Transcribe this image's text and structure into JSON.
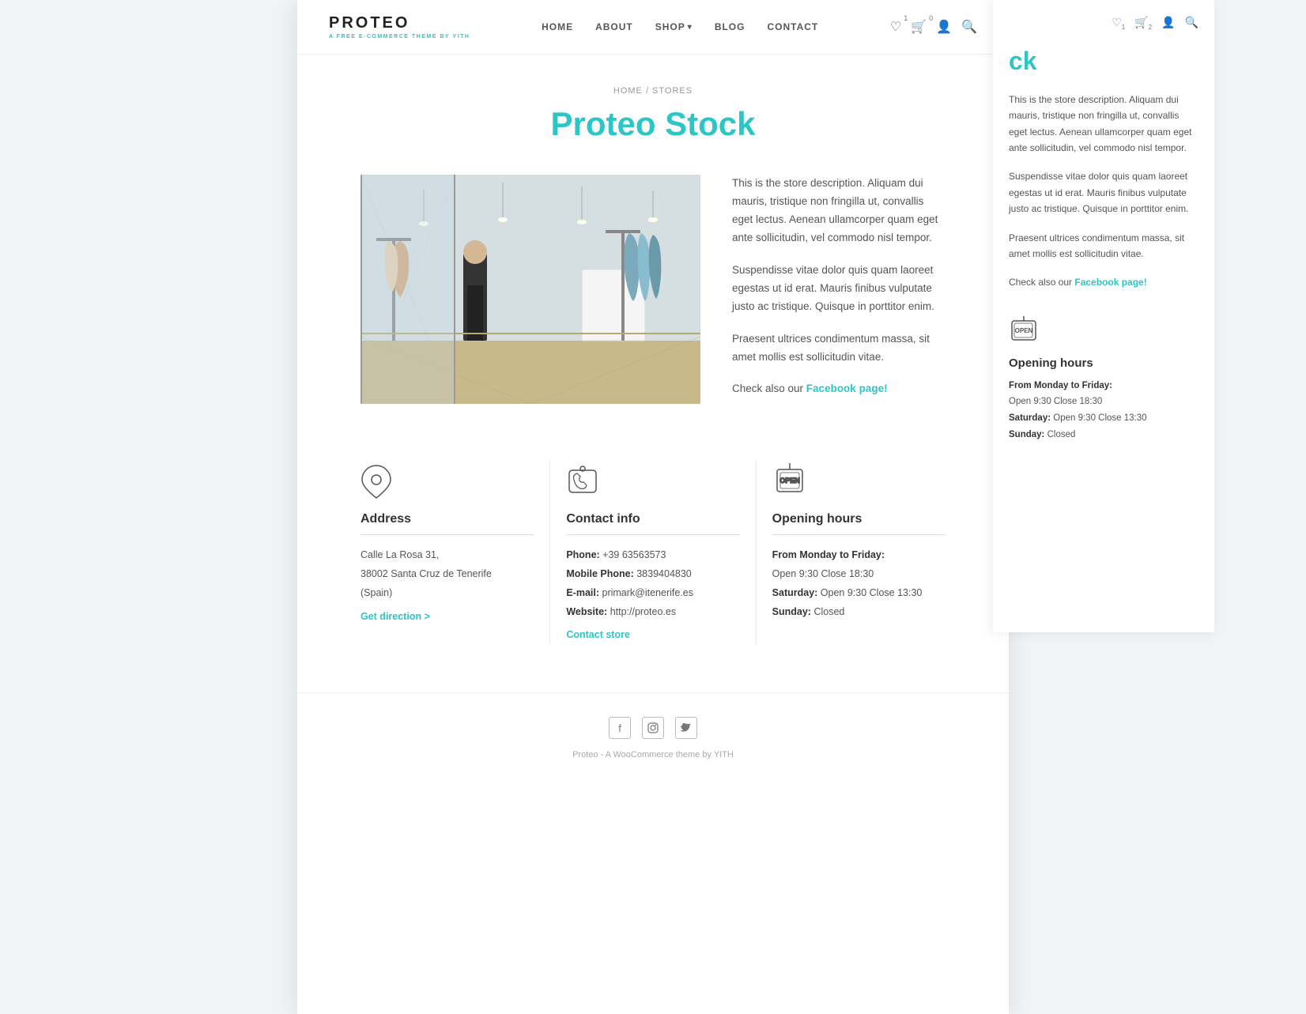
{
  "logo": {
    "text": "PROTEO",
    "sub": "A FREE E-COMMERCE THEME BY",
    "brand": "YITH"
  },
  "nav": {
    "items": [
      {
        "label": "HOME",
        "url": "#"
      },
      {
        "label": "ABOUT",
        "url": "#"
      },
      {
        "label": "SHOP",
        "url": "#",
        "hasDropdown": true
      },
      {
        "label": "BLOG",
        "url": "#"
      },
      {
        "label": "CONTACT",
        "url": "#"
      }
    ]
  },
  "header_icons": {
    "wishlist_count": "1",
    "cart_count": "0"
  },
  "breadcrumb": "HOME / STORES",
  "page_title": "Proteo Stock",
  "store_description": {
    "para1": "This is the store description. Aliquam dui mauris, tristique non fringilla ut, convallis eget lectus. Aenean ullamcorper quam eget ante sollicitudin, vel commodo nisl tempor.",
    "para2": "Suspendisse vitae dolor quis quam laoreet egestas ut id erat. Mauris finibus vulputate justo ac tristique. Quisque in porttitor enim.",
    "para3": "Praesent ultrices condimentum massa, sit amet mollis est sollicitudin vitae.",
    "facebook_prefix": "Check also our ",
    "facebook_label": "Facebook page!",
    "facebook_url": "#"
  },
  "address": {
    "title": "Address",
    "line1": "Calle La Rosa 31,",
    "line2": "38002 Santa Cruz de Tenerife",
    "line3": "(Spain)",
    "cta_label": "Get direction >",
    "cta_url": "#"
  },
  "contact_info": {
    "title": "Contact info",
    "phone_label": "Phone:",
    "phone_value": "+39 63563573",
    "mobile_label": "Mobile Phone:",
    "mobile_value": "3839404830",
    "email_label": "E-mail:",
    "email_value": "primark@itenerife.es",
    "website_label": "Website:",
    "website_value": "http://proteo.es",
    "cta_label": "Contact store",
    "cta_url": "#"
  },
  "opening_hours": {
    "title": "Opening hours",
    "weekday_label": "From Monday to Friday:",
    "weekday_value": "Open 9:30 Close 18:30",
    "saturday_label": "Saturday:",
    "saturday_value": "Open 9:30 Close 13:30",
    "sunday_label": "Sunday:",
    "sunday_value": "Closed"
  },
  "footer": {
    "social": [
      {
        "icon": "f",
        "name": "facebook"
      },
      {
        "icon": "📷",
        "name": "instagram"
      },
      {
        "icon": "🐦",
        "name": "twitter"
      }
    ],
    "copyright": "Proteo - A WooCommerce theme by YITH"
  },
  "side_panel": {
    "title": "ck",
    "desc1": "This is the store description. Aliquam dui mauris, tristique non fringilla ut, convallis eget lectus. Aenean ullamcorper quam eget ante sollicitudin, vel commodo nisl tempor.",
    "desc2": "Suspendisse vitae dolor quis quam laoreet egestas ut id erat. Mauris finibus vulputate justo ac tristique. Quisque in porttitor enim.",
    "desc3": "Praesent ultrices condimentum massa, sit amet mollis est sollicitudin vitae.",
    "facebook_prefix": "Check also our ",
    "facebook_label": "Facebook page!",
    "opening_title": "Opening hours",
    "weekday_label": "From Monday to Friday:",
    "weekday_value": "Open 9:30 Close 18:30",
    "saturday_label": "Saturday:",
    "saturday_value": "Open 9:30 Close 13:30",
    "sunday_label": "Sunday:",
    "sunday_value": "Closed"
  }
}
